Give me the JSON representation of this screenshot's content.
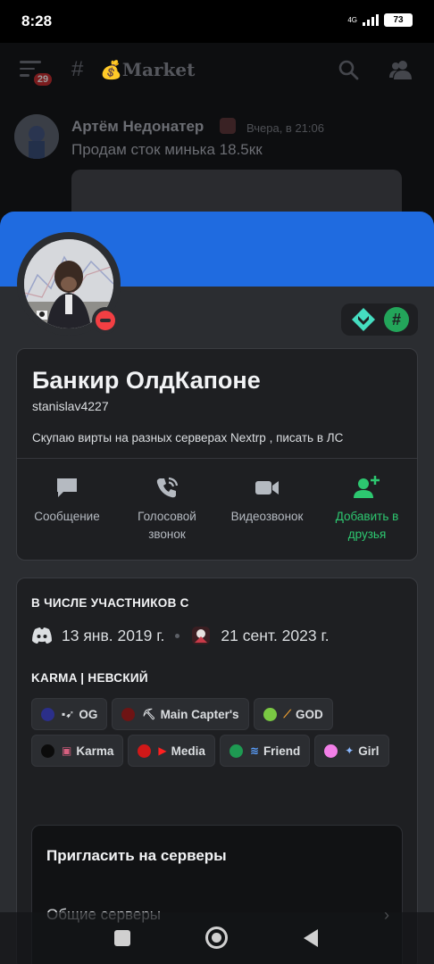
{
  "status_bar": {
    "time": "8:28",
    "network": "4G",
    "battery": "73"
  },
  "background_chat": {
    "menu_badge": "29",
    "channel_hash": "#",
    "channel_name": "💰Market",
    "message": {
      "author": "Артём Недонатер",
      "timestamp": "Вчера, в 21:06",
      "text": "Продам сток минька 18.5кк"
    }
  },
  "profile": {
    "banner_color": "#1f6be0",
    "status": "dnd",
    "display_name": "Банкир ОлдКапоне",
    "username": "stanislav4227",
    "bio": "Скупаю вирты на разных серверах Nextrp , писать в ЛС",
    "actions": [
      {
        "icon": "chat-bubble-icon",
        "label": "Сообщение"
      },
      {
        "icon": "phone-call-icon",
        "label": "Голосовой звонок"
      },
      {
        "icon": "video-camera-icon",
        "label": "Видеозвонок"
      },
      {
        "icon": "add-friend-icon",
        "label": "Добавить в друзья"
      }
    ]
  },
  "membership": {
    "title": "В ЧИСЛЕ УЧАСТНИКОВ С",
    "discord_date": "13 янв. 2019 г.",
    "server_date": "21 сент. 2023 г."
  },
  "roles_section": {
    "title": "KARMA | НЕВСКИЙ",
    "roles": [
      {
        "color": "#2b2f8a",
        "emoji": "▪➹",
        "name": "OG"
      },
      {
        "color": "#6e1414",
        "emoji": "⛏",
        "name": "Main Capter's"
      },
      {
        "color": "#7ac943",
        "emoji": "⟋",
        "name": "GOD"
      },
      {
        "color": "#0b0b0b",
        "emoji": "▣",
        "name": "Karma"
      },
      {
        "color": "#d01818",
        "emoji": "▶",
        "name": "Media"
      },
      {
        "color": "#1e9a52",
        "emoji": "≋",
        "name": "Friend"
      },
      {
        "color": "#f27fe8",
        "emoji": "✦",
        "name": "Girl"
      }
    ]
  },
  "invite": {
    "title": "Пригласить на серверы",
    "mutual_servers": "Общие серверы"
  }
}
